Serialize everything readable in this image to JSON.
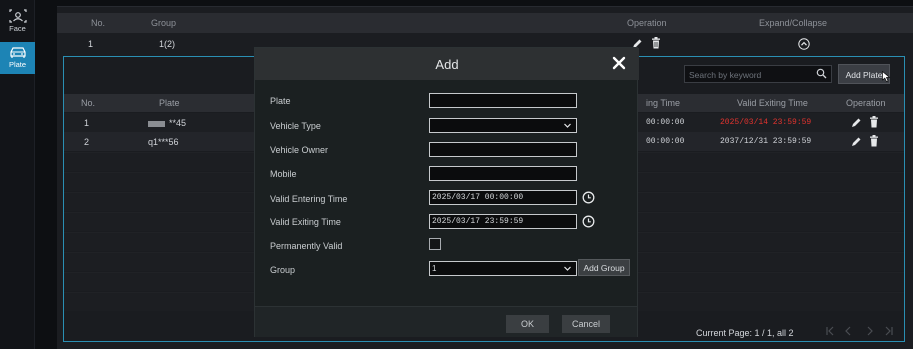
{
  "nav": {
    "face_label": "Face",
    "plate_label": "Plate"
  },
  "group_table": {
    "headers": {
      "no": "No.",
      "group": "Group",
      "operation": "Operation",
      "expand": "Expand/Collapse"
    },
    "row": {
      "no": "1",
      "group": "1(2)"
    }
  },
  "plate_table": {
    "search_placeholder": "Search by keyword",
    "add_plate_label": "Add Plate",
    "headers": {
      "no": "No.",
      "plate": "Plate",
      "entering": "ing Time",
      "exiting": "Valid Exiting Time",
      "operation": "Operation"
    },
    "rows": [
      {
        "no": "1",
        "plate": "**45",
        "entering": "00:00:00",
        "exiting": "2025/03/14 23:59:59"
      },
      {
        "no": "2",
        "plate": "q1***56",
        "entering": "00:00:00",
        "exiting": "2037/12/31 23:59:59"
      }
    ],
    "pager": "Current Page: 1 / 1, all 2"
  },
  "modal": {
    "title": "Add",
    "fields": {
      "plate_label": "Plate",
      "plate_value": "",
      "vehicle_type_label": "Vehicle Type",
      "vehicle_type_value": "",
      "vehicle_owner_label": "Vehicle Owner",
      "vehicle_owner_value": "",
      "mobile_label": "Mobile",
      "mobile_value": "",
      "entering_label": "Valid Entering Time",
      "entering_value": "2025/03/17 00:00:00",
      "exiting_label": "Valid Exiting Time",
      "exiting_value": "2025/03/17 23:59:59",
      "permanent_label": "Permanently Valid",
      "group_label": "Group",
      "group_value": "1"
    },
    "add_group_label": "Add Group",
    "ok_label": "OK",
    "cancel_label": "Cancel"
  },
  "colors": {
    "accent": "#1d84b5",
    "expired_red": "#e1332e"
  }
}
